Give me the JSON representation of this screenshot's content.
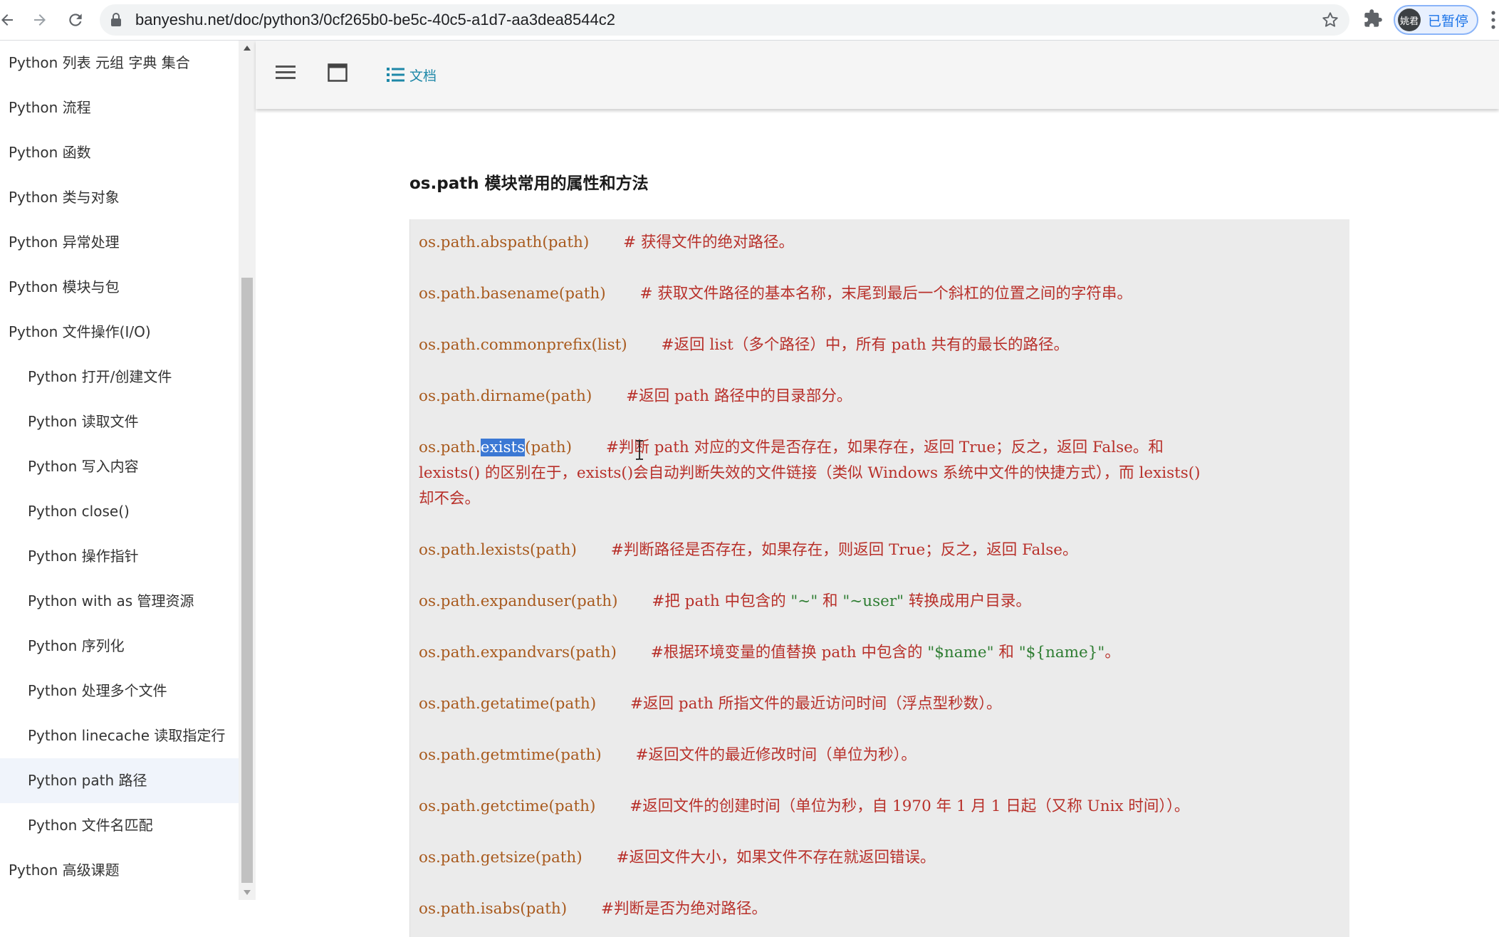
{
  "browser": {
    "url": "banyeshu.net/doc/python3/0cf265b0-be5c-40c5-a1d7-aa3dea8544c2",
    "profile_name": "姚君",
    "profile_status": "已暂停"
  },
  "sidebar": {
    "items": [
      {
        "label": "Python 列表 元组 字典 集合"
      },
      {
        "label": "Python 流程"
      },
      {
        "label": "Python 函数"
      },
      {
        "label": "Python 类与对象"
      },
      {
        "label": "Python 异常处理"
      },
      {
        "label": "Python 模块与包"
      },
      {
        "label": "Python 文件操作(I/O)"
      },
      {
        "label": "Python 打开/创建文件"
      },
      {
        "label": "Python 读取文件"
      },
      {
        "label": "Python 写入内容"
      },
      {
        "label": "Python close()"
      },
      {
        "label": "Python 操作指针"
      },
      {
        "label": "Python with as 管理资源"
      },
      {
        "label": "Python 序列化"
      },
      {
        "label": "Python 处理多个文件"
      },
      {
        "label": "Python linecache 读取指定行"
      },
      {
        "label": "Python path 路径",
        "active": true
      },
      {
        "label": "Python 文件名匹配"
      },
      {
        "label": "Python 高级课题"
      }
    ]
  },
  "toolbar": {
    "doc_label": "文档"
  },
  "content": {
    "section_title": "os.path 模块常用的属性和方法",
    "entries": [
      {
        "code": "os.path.abspath(path)",
        "comment": "# 获得文件的绝对路径。"
      },
      {
        "code": "os.path.basename(path)",
        "comment": "# 获取文件路径的基本名称，末尾到最后一个斜杠的位置之间的字符串。"
      },
      {
        "code": "os.path.commonprefix(list)",
        "comment": "#返回 list（多个路径）中，所有 path 共有的最长的路径。"
      },
      {
        "code": "os.path.dirname(path)",
        "comment": "#返回 path 路径中的目录部分。"
      },
      {
        "code_prefix": "os.path.",
        "code_selected": "exists",
        "code_suffix": "(path)",
        "comment_line1": "#判断 path 对应的文件是否存在，如果存在，返回 True；反之，返回 False。和",
        "comment_line2": "lexists() 的区别在于，exists()会自动判断失效的文件链接（类似 Windows 系统中文件的快捷方式），而 lexists()",
        "comment_line3": "却不会。"
      },
      {
        "code": "os.path.lexists(path)",
        "comment": "#判断路径是否存在，如果存在，则返回 True；反之，返回 False。"
      },
      {
        "code": "os.path.expanduser(path)",
        "comment_a": "#把 path 中包含的 ",
        "str_a": "\"~\"",
        "comment_b": " 和 ",
        "str_b": "\"~user\"",
        "comment_c": " 转换成用户目录。"
      },
      {
        "code": "os.path.expandvars(path)",
        "comment_a": "#根据环境变量的值替换 path 中包含的 ",
        "str_a": "\"$name\"",
        "comment_b": " 和 ",
        "str_b": "\"${name}\"",
        "comment_c": "。"
      },
      {
        "code": "os.path.getatime(path)",
        "comment": "#返回 path 所指文件的最近访问时间（浮点型秒数）。"
      },
      {
        "code": "os.path.getmtime(path)",
        "comment": "#返回文件的最近修改时间（单位为秒）。"
      },
      {
        "code": "os.path.getctime(path)",
        "comment": "#返回文件的创建时间（单位为秒，自 1970 年 1 月 1 日起（又称 Unix 时间））。"
      },
      {
        "code": "os.path.getsize(path)",
        "comment": "#返回文件大小，如果文件不存在就返回错误。"
      },
      {
        "code": "os.path.isabs(path)",
        "comment": "#判断是否为绝对路径。"
      }
    ]
  },
  "colors": {
    "code": "#a85a1e",
    "comment": "#b8302a",
    "string": "#2e7d32",
    "selection": "#3b78d4",
    "accent": "#1e88a8"
  }
}
